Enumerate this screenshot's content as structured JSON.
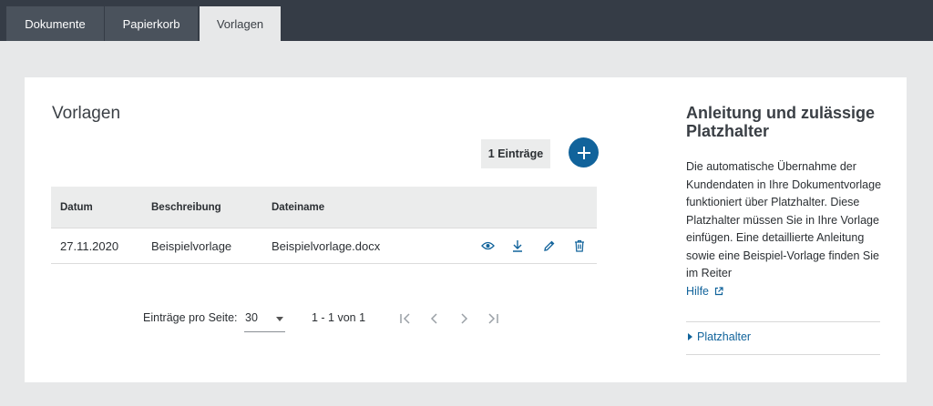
{
  "tabs": [
    {
      "label": "Dokumente",
      "active": false
    },
    {
      "label": "Papierkorb",
      "active": false
    },
    {
      "label": "Vorlagen",
      "active": true
    }
  ],
  "main": {
    "title": "Vorlagen",
    "count_label": "1 Einträge",
    "add_icon": "plus-icon",
    "table": {
      "headers": [
        "Datum",
        "Beschreibung",
        "Dateiname"
      ],
      "rows": [
        {
          "date": "27.11.2020",
          "description": "Beispielvorlage",
          "filename": "Beispielvorlage.docx",
          "actions": [
            "eye-icon",
            "download-icon",
            "pencil-icon",
            "trash-icon"
          ]
        }
      ]
    },
    "pagination": {
      "per_page_label": "Einträge pro Seite:",
      "per_page_value": "30",
      "range_label": "1 - 1 von 1"
    }
  },
  "sidebar": {
    "title": "Anleitung und zulässige Platzhalter",
    "description": "Die automatische Übernahme der Kundendaten in Ihre Dokumentvorlage funktioniert über Platzhalter. Diese Platzhalter müssen Sie in Ihre Vorlage einfügen. Eine detaillierte Anleitung sowie eine Beispiel-Vorlage finden Sie im Reiter",
    "help_link": "Hilfe",
    "accordion_label": "Platzhalter"
  },
  "colors": {
    "accent": "#11639b",
    "topbar": "#353c46",
    "tab": "#4a525c",
    "background": "#e7e8e9"
  }
}
